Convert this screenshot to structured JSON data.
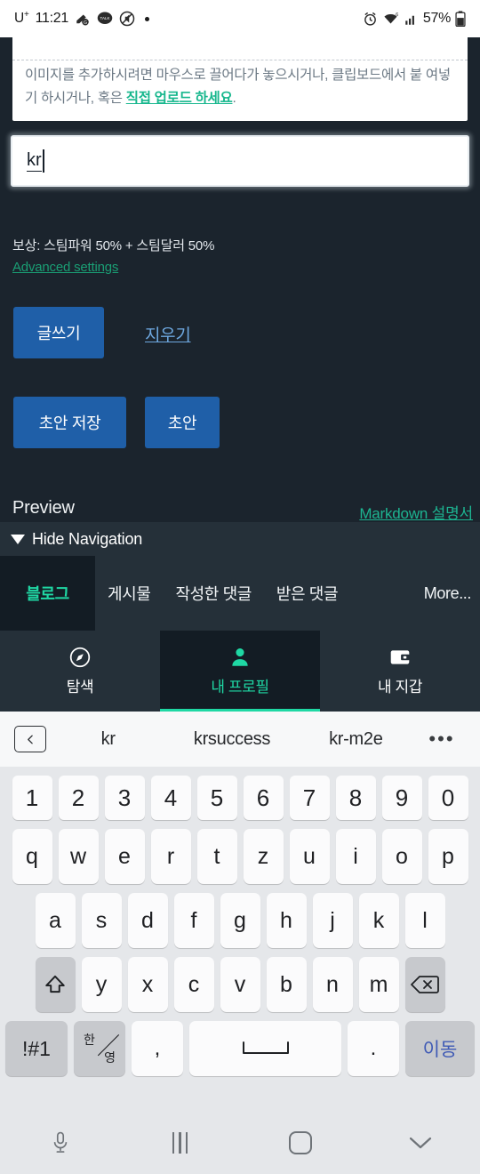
{
  "statusbar": {
    "carrier": "U",
    "carrier_sup": "+",
    "time": "11:21",
    "icons": [
      "notification-icon",
      "kakaotalk-icon",
      "mute-icon",
      "dot-icon"
    ],
    "right_icons": [
      "alarm-icon",
      "wifi-icon",
      "signal-icon",
      "battery-icon"
    ],
    "battery_percent": "57%"
  },
  "editor": {
    "hint_line1": "이미지를 추가하시려면 마우스로 끌어다가 놓으시거나, 클립보드에서 붙",
    "hint_line2a": "여넣기 하시거나, 혹은 ",
    "hint_upload_link": "직접 업로드 하세요",
    "hint_line2b": ".",
    "title_value": "kr"
  },
  "post_options": {
    "reward": "보상: 스팀파워 50% + 스팀달러 50%",
    "advanced_settings": "Advanced settings",
    "post_button": "글쓰기",
    "clear_link": "지우기",
    "save_draft_button": "초안 저장",
    "draft_button": "초안"
  },
  "preview": {
    "label": "Preview",
    "markdown_link": "Markdown 설명서"
  },
  "navigation": {
    "hide_navigation": "Hide Navigation",
    "tabs": [
      {
        "label": "블로그",
        "active": true
      },
      {
        "label": "게시물",
        "active": false
      },
      {
        "label": "작성한 댓글",
        "active": false
      },
      {
        "label": "받은 댓글",
        "active": false
      },
      {
        "label": "More...",
        "active": false
      }
    ]
  },
  "bottom_nav": [
    {
      "label": "탐색",
      "icon": "compass-icon",
      "active": false
    },
    {
      "label": "내 프로필",
      "icon": "person-icon",
      "active": true
    },
    {
      "label": "내 지갑",
      "icon": "wallet-icon",
      "active": false
    }
  ],
  "keyboard": {
    "suggestions": [
      "kr",
      "krsuccess",
      "kr-m2e"
    ],
    "back_icon": "chevron-left-icon",
    "more_icon": "overflow-dots-icon",
    "row_numbers": [
      "1",
      "2",
      "3",
      "4",
      "5",
      "6",
      "7",
      "8",
      "9",
      "0"
    ],
    "row1": [
      "q",
      "w",
      "e",
      "r",
      "t",
      "z",
      "u",
      "i",
      "o",
      "p"
    ],
    "row2": [
      "a",
      "s",
      "d",
      "f",
      "g",
      "h",
      "j",
      "k",
      "l"
    ],
    "row3": [
      "y",
      "x",
      "c",
      "v",
      "b",
      "n",
      "m"
    ],
    "shift_icon": "shift-arrow-icon",
    "backspace_icon": "backspace-icon",
    "symbols_key": "!#1",
    "lang_key_han": "한",
    "lang_key_yeong": "영",
    "comma_key": ",",
    "space_key": "space-bar-icon",
    "period_key": ".",
    "go_key": "이동"
  },
  "system_nav": {
    "mic_icon": "microphone-icon",
    "recents_icon": "recents-icon",
    "home_icon": "home-icon",
    "dismiss_icon": "chevron-down-icon"
  },
  "colors": {
    "app_bg": "#1b242d",
    "panel_bg": "#253039",
    "accent_green": "#1fd8a4",
    "link_green": "#1db491",
    "button_blue": "#1f5fa8",
    "keyboard_bg": "#e5e7ea"
  }
}
